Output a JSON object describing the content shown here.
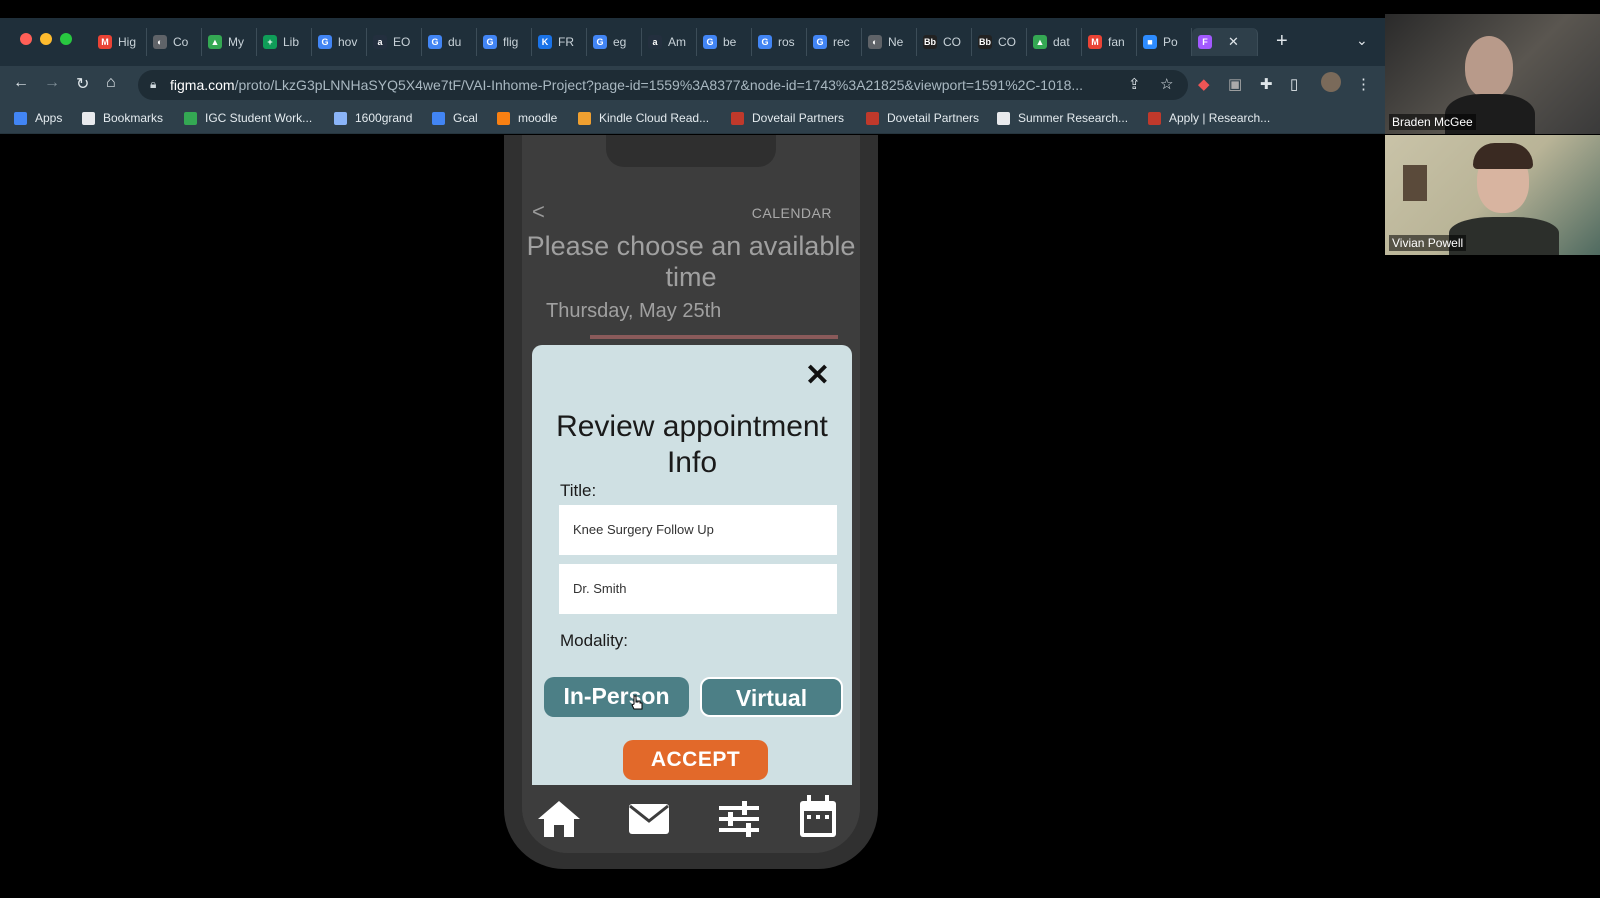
{
  "browser": {
    "tabs": [
      {
        "label": "Hig",
        "icon": "gmail-icon",
        "color": "#ea4335",
        "glyph": "M"
      },
      {
        "label": "Co",
        "icon": "chrome-icon",
        "color": "#5f6368",
        "glyph": "◐"
      },
      {
        "label": "My",
        "icon": "drive-icon",
        "color": "#34a853",
        "glyph": "▲"
      },
      {
        "label": "Lib",
        "icon": "sheets-icon",
        "color": "#0f9d58",
        "glyph": "+"
      },
      {
        "label": "hov",
        "icon": "google-icon",
        "color": "#4285f4",
        "glyph": "G"
      },
      {
        "label": "EO",
        "icon": "amazon-icon",
        "color": "#232f3e",
        "glyph": "a"
      },
      {
        "label": "du",
        "icon": "google-icon",
        "color": "#4285f4",
        "glyph": "G"
      },
      {
        "label": "flig",
        "icon": "google-icon",
        "color": "#4285f4",
        "glyph": "G"
      },
      {
        "label": "FR",
        "icon": "kindle-icon",
        "color": "#1a73e8",
        "glyph": "K"
      },
      {
        "label": "eg",
        "icon": "google-icon",
        "color": "#4285f4",
        "glyph": "G"
      },
      {
        "label": "Am",
        "icon": "amazon-icon",
        "color": "#232f3e",
        "glyph": "a"
      },
      {
        "label": "be",
        "icon": "google-icon",
        "color": "#4285f4",
        "glyph": "G"
      },
      {
        "label": "ros",
        "icon": "google-icon",
        "color": "#4285f4",
        "glyph": "G"
      },
      {
        "label": "rec",
        "icon": "google-icon",
        "color": "#4285f4",
        "glyph": "G"
      },
      {
        "label": "Ne",
        "icon": "chrome-icon",
        "color": "#5f6368",
        "glyph": "◐"
      },
      {
        "label": "CO",
        "icon": "blackboard-icon",
        "color": "#222222",
        "glyph": "Bb"
      },
      {
        "label": "CO",
        "icon": "blackboard-icon",
        "color": "#222222",
        "glyph": "Bb"
      },
      {
        "label": "dat",
        "icon": "drive-icon",
        "color": "#34a853",
        "glyph": "▲"
      },
      {
        "label": "fan",
        "icon": "gmail-icon",
        "color": "#ea4335",
        "glyph": "M"
      },
      {
        "label": "Po",
        "icon": "zoom-icon",
        "color": "#2d8cff",
        "glyph": "■"
      }
    ],
    "url_host": "figma.com",
    "url_path": "/proto/LkzG3pLNNHaSYQ5X4we7tF/VAI-Inhome-Project?page-id=1559%3A8377&node-id=1743%3A21825&viewport=1591%2C-1018...",
    "bookmarks": [
      {
        "label": "Apps",
        "icon": "apps-grid-icon",
        "color": "#4285f4"
      },
      {
        "label": "Bookmarks",
        "icon": "star-icon",
        "color": "#e8eaed"
      },
      {
        "label": "IGC Student Work...",
        "icon": "folder-icon",
        "color": "#34a853"
      },
      {
        "label": "1600grand",
        "icon": "shield-icon",
        "color": "#8ab4f8"
      },
      {
        "label": "Gcal",
        "icon": "calendar-icon",
        "color": "#4285f4"
      },
      {
        "label": "moodle",
        "icon": "moodle-icon",
        "color": "#f98012"
      },
      {
        "label": "Kindle Cloud Read...",
        "icon": "kindle-icon",
        "color": "#f0a030"
      },
      {
        "label": "Dovetail Partners",
        "icon": "dovetail-icon",
        "color": "#c0392b"
      },
      {
        "label": "Dovetail Partners",
        "icon": "dovetail-icon",
        "color": "#c0392b"
      },
      {
        "label": "Summer Research...",
        "icon": "globe-icon",
        "color": "#e8eaed"
      },
      {
        "label": "Apply | Research...",
        "icon": "research-icon",
        "color": "#c0392b"
      }
    ]
  },
  "phone": {
    "header_label": "CALENDAR",
    "prompt": "Please choose an available time",
    "date": "Thursday, May 25th"
  },
  "modal": {
    "title": "Review appointment Info",
    "title_label": "Title:",
    "title_value": "Knee Surgery Follow Up",
    "doctor_value": "Dr. Smith",
    "modality_label": "Modality:",
    "option_in_person": "In-Person",
    "option_virtual": "Virtual",
    "accept_label": "ACCEPT"
  },
  "participants": [
    {
      "name": "Braden McGee"
    },
    {
      "name": "Vivian Powell"
    }
  ],
  "colors": {
    "modal_bg": "#cfe0e3",
    "modality_button": "#4c7f86",
    "accept_button": "#e2692a"
  }
}
